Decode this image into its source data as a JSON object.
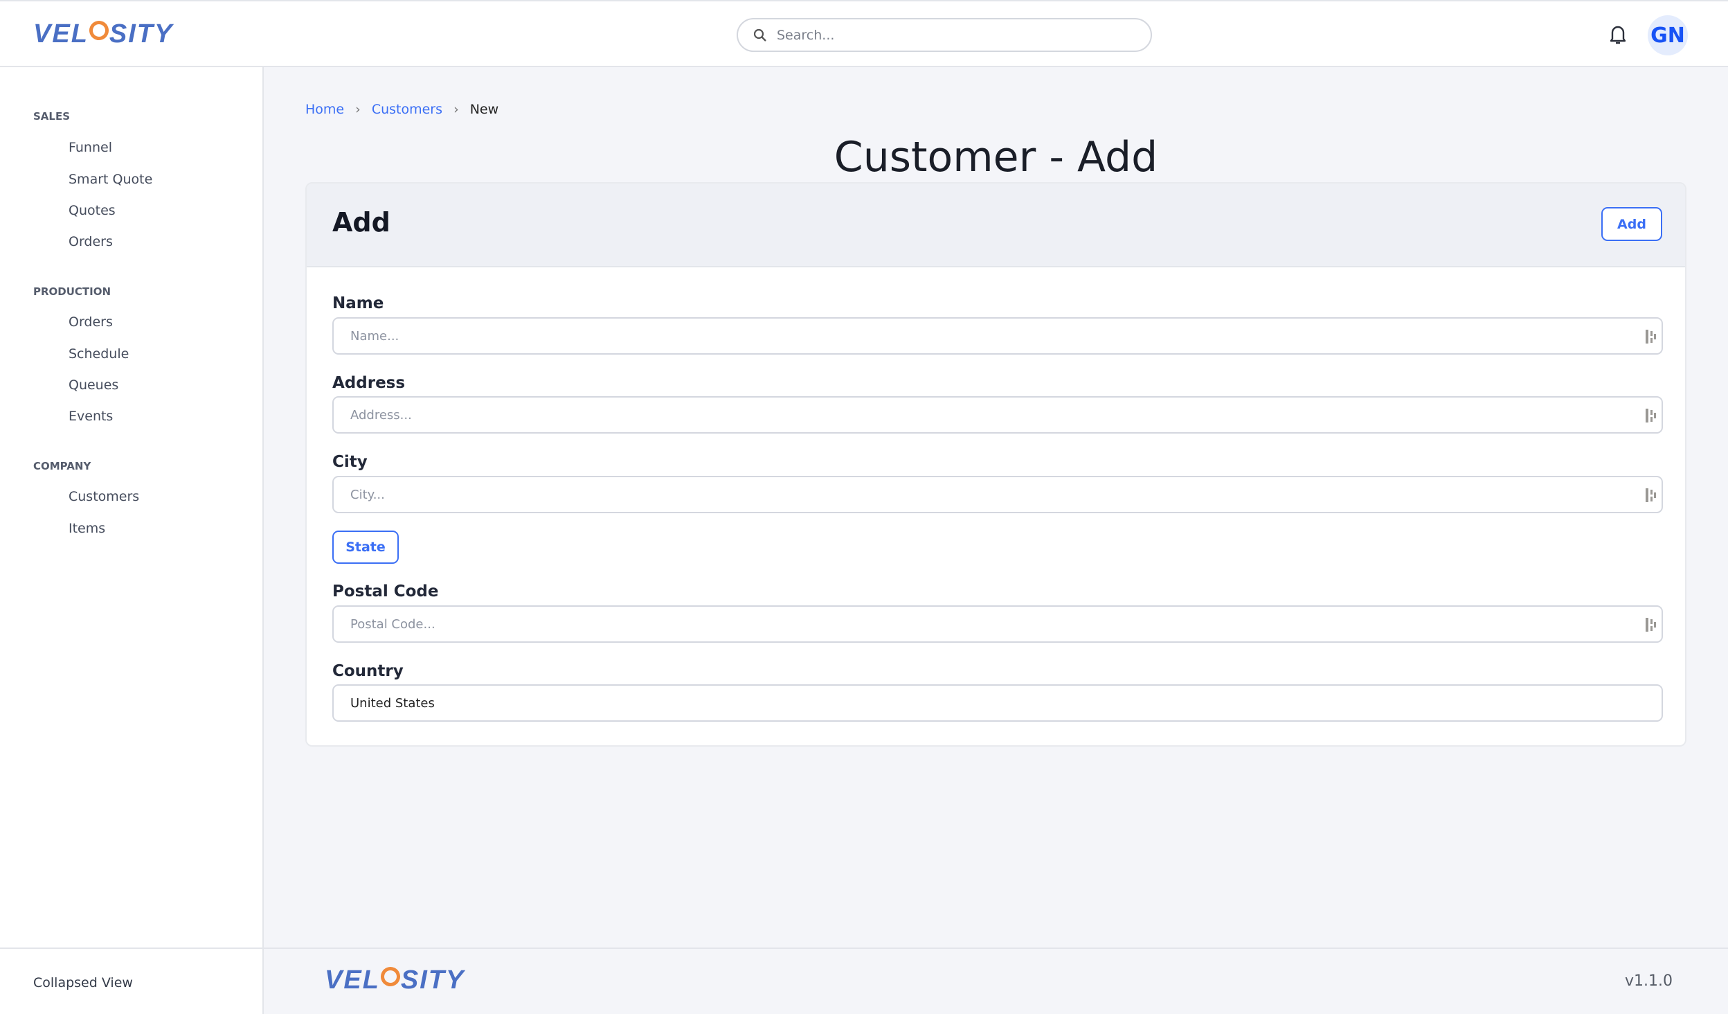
{
  "header": {
    "logo": "VELOCITY",
    "search_placeholder": "Search...",
    "avatar_initials": "GN"
  },
  "sidebar": {
    "sections": [
      {
        "title": "SALES",
        "items": [
          "Funnel",
          "Smart Quote",
          "Quotes",
          "Orders"
        ]
      },
      {
        "title": "PRODUCTION",
        "items": [
          "Orders",
          "Schedule",
          "Queues",
          "Events"
        ]
      },
      {
        "title": "COMPANY",
        "items": [
          "Customers",
          "Items"
        ]
      }
    ],
    "collapse_label": "Collapsed View"
  },
  "breadcrumb": [
    "Home",
    "Customers",
    "New"
  ],
  "page_title": "Customer - Add",
  "card": {
    "title": "Add",
    "add_button": "Add",
    "fields": {
      "name": {
        "label": "Name",
        "placeholder": "Name...",
        "value": ""
      },
      "address": {
        "label": "Address",
        "placeholder": "Address...",
        "value": ""
      },
      "city": {
        "label": "City",
        "placeholder": "City...",
        "value": ""
      },
      "state_button": "State",
      "postal": {
        "label": "Postal Code",
        "placeholder": "Postal Code...",
        "value": ""
      },
      "country": {
        "label": "Country",
        "value": "United States"
      }
    }
  },
  "footer": {
    "logo": "VELOCITY",
    "version": "v1.1.0"
  },
  "colors": {
    "accent": "#3b6ff5",
    "logo_blue": "#4a6fc4",
    "logo_orange": "#f08a3a",
    "avatar": "#1853f5"
  }
}
